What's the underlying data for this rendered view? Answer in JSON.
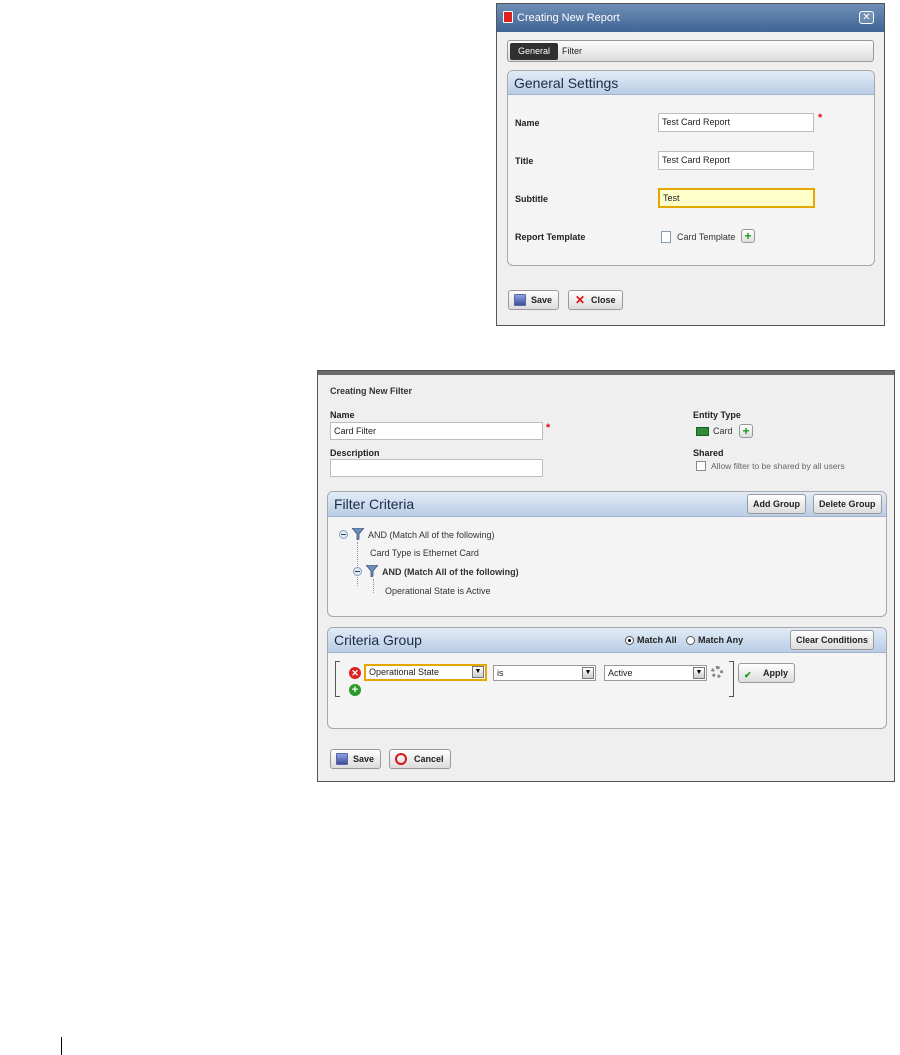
{
  "report_dialog": {
    "title": "Creating New Report",
    "tabs": [
      "General",
      "Filter"
    ],
    "section_title": "General Settings",
    "fields": {
      "name_label": "Name",
      "name_value": "Test Card Report",
      "title_label": "Title",
      "title_value": "Test Card Report",
      "subtitle_label": "Subtitle",
      "subtitle_value": "Test",
      "template_label": "Report Template",
      "template_value": "Card Template"
    },
    "buttons": {
      "save": "Save",
      "close": "Close"
    }
  },
  "filter_dialog": {
    "title": "Creating New Filter",
    "name_label": "Name",
    "name_value": "Card Filter",
    "description_label": "Description",
    "description_value": "",
    "entity_type_label": "Entity Type",
    "entity_type_value": "Card",
    "shared_label": "Shared",
    "shared_checkbox_label": "Allow filter to be shared by all users",
    "filter_criteria": {
      "title": "Filter Criteria",
      "add_group": "Add Group",
      "delete_group": "Delete Group",
      "tree": {
        "root": "AND (Match All of the following)",
        "root_condition": "Card Type is Ethernet Card",
        "child": "AND (Match All of the following)",
        "child_condition": "Operational State is Active"
      }
    },
    "criteria_group": {
      "title": "Criteria Group",
      "match_all": "Match All",
      "match_any": "Match Any",
      "clear_conditions": "Clear Conditions",
      "attribute": "Operational State",
      "operator": "is",
      "value": "Active",
      "apply": "Apply"
    },
    "buttons": {
      "save": "Save",
      "cancel": "Cancel"
    }
  },
  "colors": {
    "header_blue": "#b9cde5",
    "focus_yellow": "#ffffcc",
    "required_red": "#d11111"
  }
}
